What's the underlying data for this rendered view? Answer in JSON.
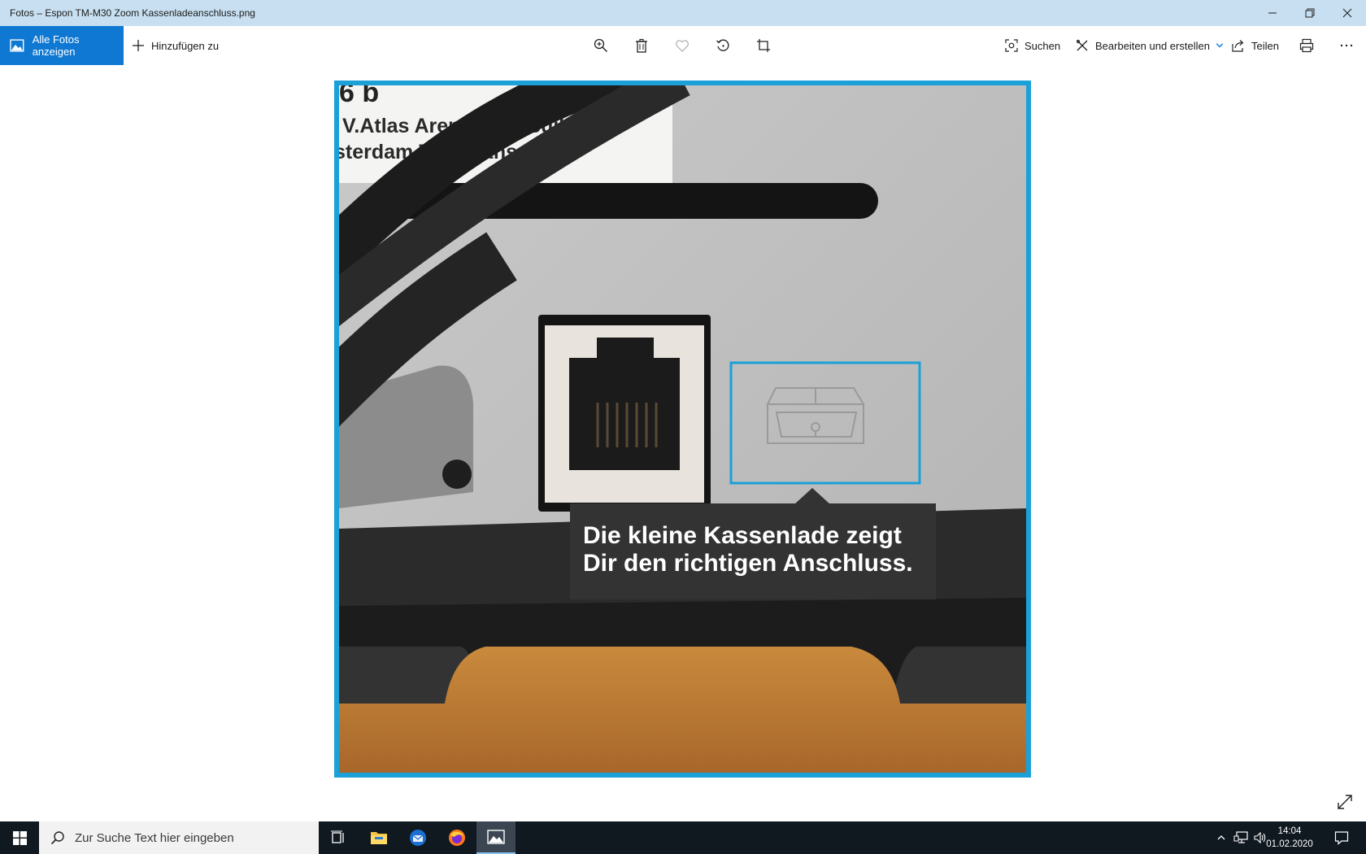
{
  "window": {
    "title": "Fotos – Espon TM-M30 Zoom Kassenladeanschluss.png",
    "controls": [
      "minimize-icon",
      "restore-icon",
      "close-icon"
    ]
  },
  "toolbar": {
    "all_photos_label": "Alle Fotos anzeigen",
    "add_to_label": "Hinzufügen zu",
    "center_tools": [
      "zoom-in-icon",
      "delete-icon",
      "favorite-icon",
      "rotate-icon",
      "crop-icon"
    ],
    "search_label": "Suchen",
    "edit_label": "Bearbeiten und erstellen",
    "share_label": "Teilen",
    "accent_color": "#0f78d3"
  },
  "photo": {
    "label_line1": "V.Atlas Arena,Asia Buil",
    "label_line2": "sterdam The Neths",
    "label_top": "6 b",
    "callout_line1": "Die kleine Kassenlade zeigt",
    "callout_line2": "Dir den richtigen Anschluss.",
    "frame_color": "#1ba0d7"
  },
  "taskbar": {
    "search_placeholder": "Zur Suche Text hier eingeben",
    "apps": [
      "task-view-icon",
      "file-explorer-icon",
      "thunderbird-icon",
      "firefox-icon",
      "photos-icon"
    ],
    "time": "14:04",
    "date": "01.02.2020"
  }
}
